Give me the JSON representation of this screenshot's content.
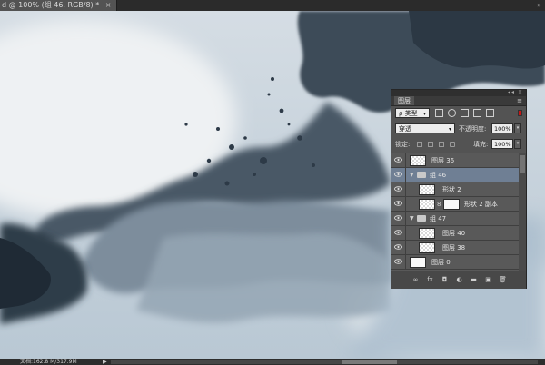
{
  "document": {
    "tab_title": "d @ 100% (组 46, RGB/8) *",
    "tab_close": "×",
    "collapse_glyph": "»"
  },
  "status_bar": {
    "doc_size": "文档:162.8 M/317.9M",
    "menu_arrow": "▶"
  },
  "layers_panel": {
    "tab_label": "图层",
    "window_controls": "◂◂ ×",
    "menu_glyph": "≡",
    "filter": {
      "kind_label": "ρ 类型",
      "caret": "▾"
    },
    "blend_mode": {
      "value": "穿透",
      "caret": "▾"
    },
    "opacity": {
      "label": "不透明度:",
      "value": "100%",
      "step": "▾"
    },
    "lock": {
      "label": "锁定:"
    },
    "fill": {
      "label": "填充:",
      "value": "100%",
      "step": "▾"
    },
    "layers": [
      {
        "name": "图层 36",
        "kind": "pixel",
        "indent": 0
      },
      {
        "name": "组 46",
        "kind": "group",
        "indent": 0,
        "expanded": true,
        "selected": true
      },
      {
        "name": "形状 2",
        "kind": "shape",
        "indent": 1
      },
      {
        "name": "形状 2 副本",
        "kind": "shape-mask",
        "indent": 1
      },
      {
        "name": "组 47",
        "kind": "group",
        "indent": 0,
        "expanded": true
      },
      {
        "name": "图层 40",
        "kind": "pixel",
        "indent": 1
      },
      {
        "name": "图层 38",
        "kind": "pixel",
        "indent": 1
      },
      {
        "name": "图层 0",
        "kind": "white",
        "indent": 0
      }
    ],
    "bottom_icons": [
      "link-icon",
      "fx-icon",
      "mask-icon",
      "adjustment-icon",
      "folder-icon",
      "new-layer-icon",
      "trash-icon"
    ],
    "bottom_glyphs": [
      "∞",
      "fx",
      "◘",
      "◐",
      "▬",
      "▣",
      "🗑"
    ]
  },
  "colors": {
    "panel_bg": "#535353",
    "selected_row": "#6f7f94",
    "canvas_ink": "#2f3c4a",
    "canvas_wash": "#c9d4dd"
  }
}
